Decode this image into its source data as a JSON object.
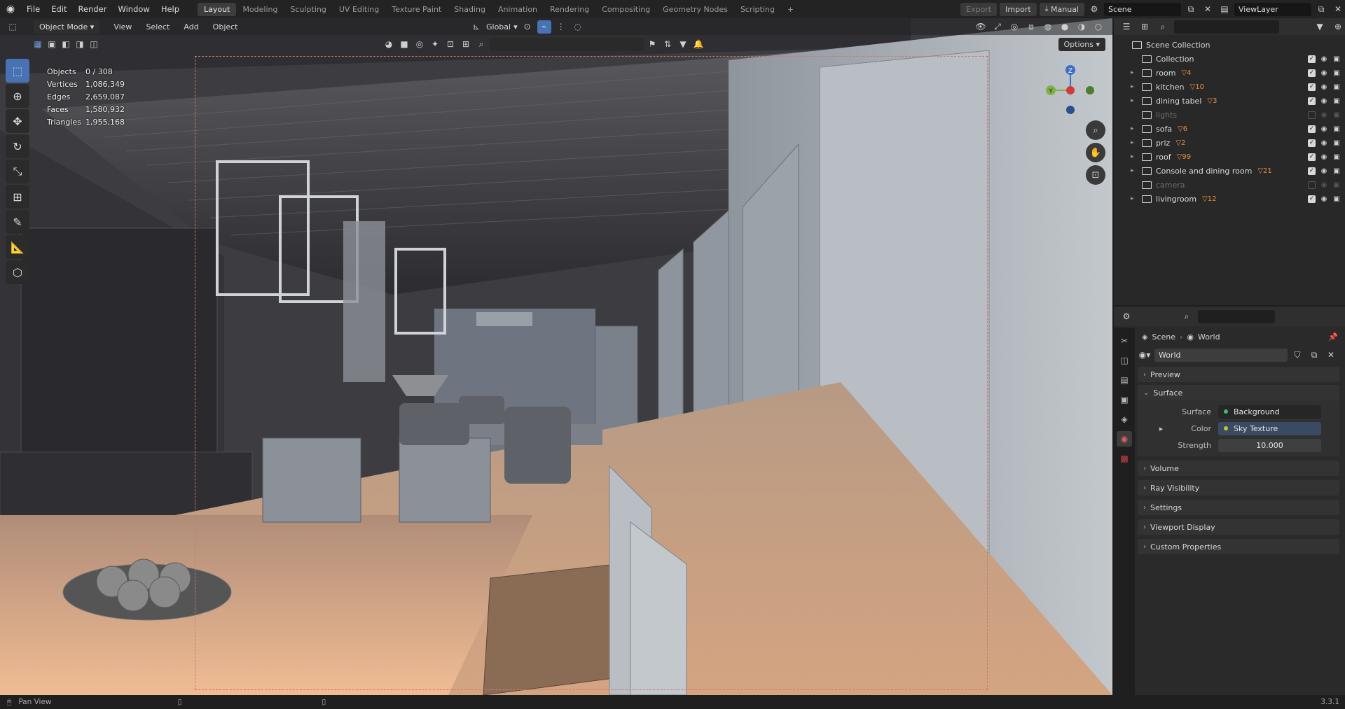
{
  "menu": [
    "File",
    "Edit",
    "Render",
    "Window",
    "Help"
  ],
  "workspaces": [
    "Layout",
    "Modeling",
    "Sculpting",
    "UV Editing",
    "Texture Paint",
    "Shading",
    "Animation",
    "Rendering",
    "Compositing",
    "Geometry Nodes",
    "Scripting"
  ],
  "topright": {
    "export": "Export",
    "import": "Import",
    "manual": "Manual",
    "scene": "Scene",
    "viewlayer": "ViewLayer"
  },
  "viewport": {
    "mode": "Object Mode",
    "menu": [
      "View",
      "Select",
      "Add",
      "Object"
    ],
    "orientation": "Global",
    "options": "Options",
    "stats": [
      {
        "k": "Objects",
        "v": "0 / 308"
      },
      {
        "k": "Vertices",
        "v": "1,086,349"
      },
      {
        "k": "Edges",
        "v": "2,659,087"
      },
      {
        "k": "Faces",
        "v": "1,580,932"
      },
      {
        "k": "Triangles",
        "v": "1,955,168"
      }
    ],
    "gizmo": {
      "z": "Z",
      "y": "Y"
    }
  },
  "outliner": {
    "root": "Scene Collection",
    "items": [
      {
        "name": "Collection",
        "count": "",
        "dim": false,
        "expand": ""
      },
      {
        "name": "room",
        "count": "4",
        "dim": false,
        "expand": "▸"
      },
      {
        "name": "kitchen",
        "count": "10",
        "dim": false,
        "expand": "▸"
      },
      {
        "name": "dining tabel",
        "count": "3",
        "dim": false,
        "expand": "▸"
      },
      {
        "name": "lights",
        "count": "",
        "dim": true,
        "expand": ""
      },
      {
        "name": "sofa",
        "count": "6",
        "dim": false,
        "expand": "▸"
      },
      {
        "name": "priz",
        "count": "2",
        "dim": false,
        "expand": "▸"
      },
      {
        "name": "roof",
        "count": "99",
        "dim": false,
        "expand": "▸"
      },
      {
        "name": "Console and dining room",
        "count": "21",
        "dim": false,
        "expand": "▸"
      },
      {
        "name": "camera",
        "count": "",
        "dim": true,
        "expand": ""
      },
      {
        "name": "livingroom",
        "count": "12",
        "dim": false,
        "expand": "▸"
      }
    ]
  },
  "properties": {
    "breadcrumb_scene": "Scene",
    "breadcrumb_world": "World",
    "world_name": "World",
    "panels_top": [
      "Preview",
      "Surface"
    ],
    "surface_label": "Surface",
    "surface_value": "Background",
    "color_label": "Color",
    "color_value": "Sky Texture",
    "strength_label": "Strength",
    "strength_value": "10.000",
    "panels_bottom": [
      "Volume",
      "Ray Visibility",
      "Settings",
      "Viewport Display",
      "Custom Properties"
    ]
  },
  "status": {
    "left": "Pan View",
    "version": "3.3.1"
  }
}
